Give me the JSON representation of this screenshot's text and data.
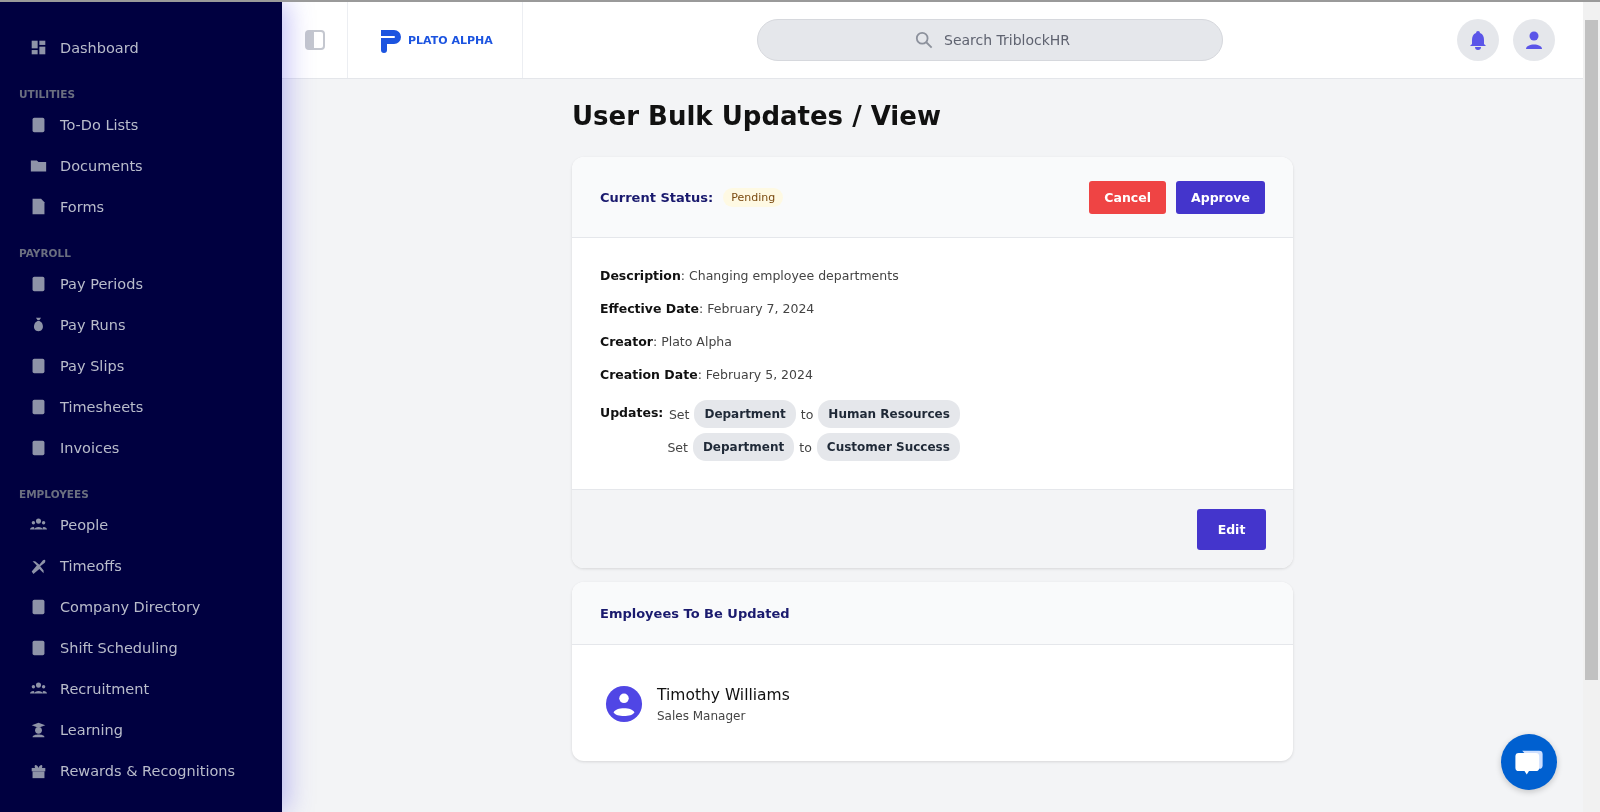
{
  "sidebar": {
    "sections": [
      {
        "items": [
          {
            "label": "Dashboard"
          }
        ]
      },
      {
        "heading": "UTILITIES",
        "items": [
          {
            "label": "To-Do Lists"
          },
          {
            "label": "Documents"
          },
          {
            "label": "Forms"
          }
        ]
      },
      {
        "heading": "PAYROLL",
        "items": [
          {
            "label": "Pay Periods"
          },
          {
            "label": "Pay Runs"
          },
          {
            "label": "Pay Slips"
          },
          {
            "label": "Timesheets"
          },
          {
            "label": "Invoices"
          }
        ]
      },
      {
        "heading": "EMPLOYEES",
        "items": [
          {
            "label": "People"
          },
          {
            "label": "Timeoffs"
          },
          {
            "label": "Company Directory"
          },
          {
            "label": "Shift Scheduling"
          },
          {
            "label": "Recruitment"
          },
          {
            "label": "Learning"
          },
          {
            "label": "Rewards & Recognitions"
          }
        ]
      }
    ]
  },
  "header": {
    "logo_text": "PLATO ALPHA",
    "search": {
      "placeholder": "Search TriblockHR"
    }
  },
  "page_title": "User Bulk Updates / View",
  "status_card": {
    "label": "Current Status:",
    "status": "Pending",
    "buttons": [
      {
        "label": "Cancel",
        "kind": "danger"
      },
      {
        "label": "Approve",
        "kind": "primary"
      }
    ],
    "fields": [
      "**Description**: Changing employee departments",
      "**Effective Date**: February 7, 2024",
      "**Creator**: Plato Alpha",
      "**Creation Date**: February 5, 2024"
    ],
    "updates_label": "Updates:",
    "updates": [
      {
        "set": "Set",
        "field": "Department",
        "to": "to",
        "value": "Human Resources"
      },
      {
        "set": "Set",
        "field": "Department",
        "to": "to",
        "value": "Customer Success"
      }
    ],
    "footer_button": "Edit"
  },
  "employees_card": {
    "title": "Employees To Be Updated",
    "employees": [
      {
        "name": "Timothy Williams",
        "role": "Sales Manager"
      }
    ]
  }
}
